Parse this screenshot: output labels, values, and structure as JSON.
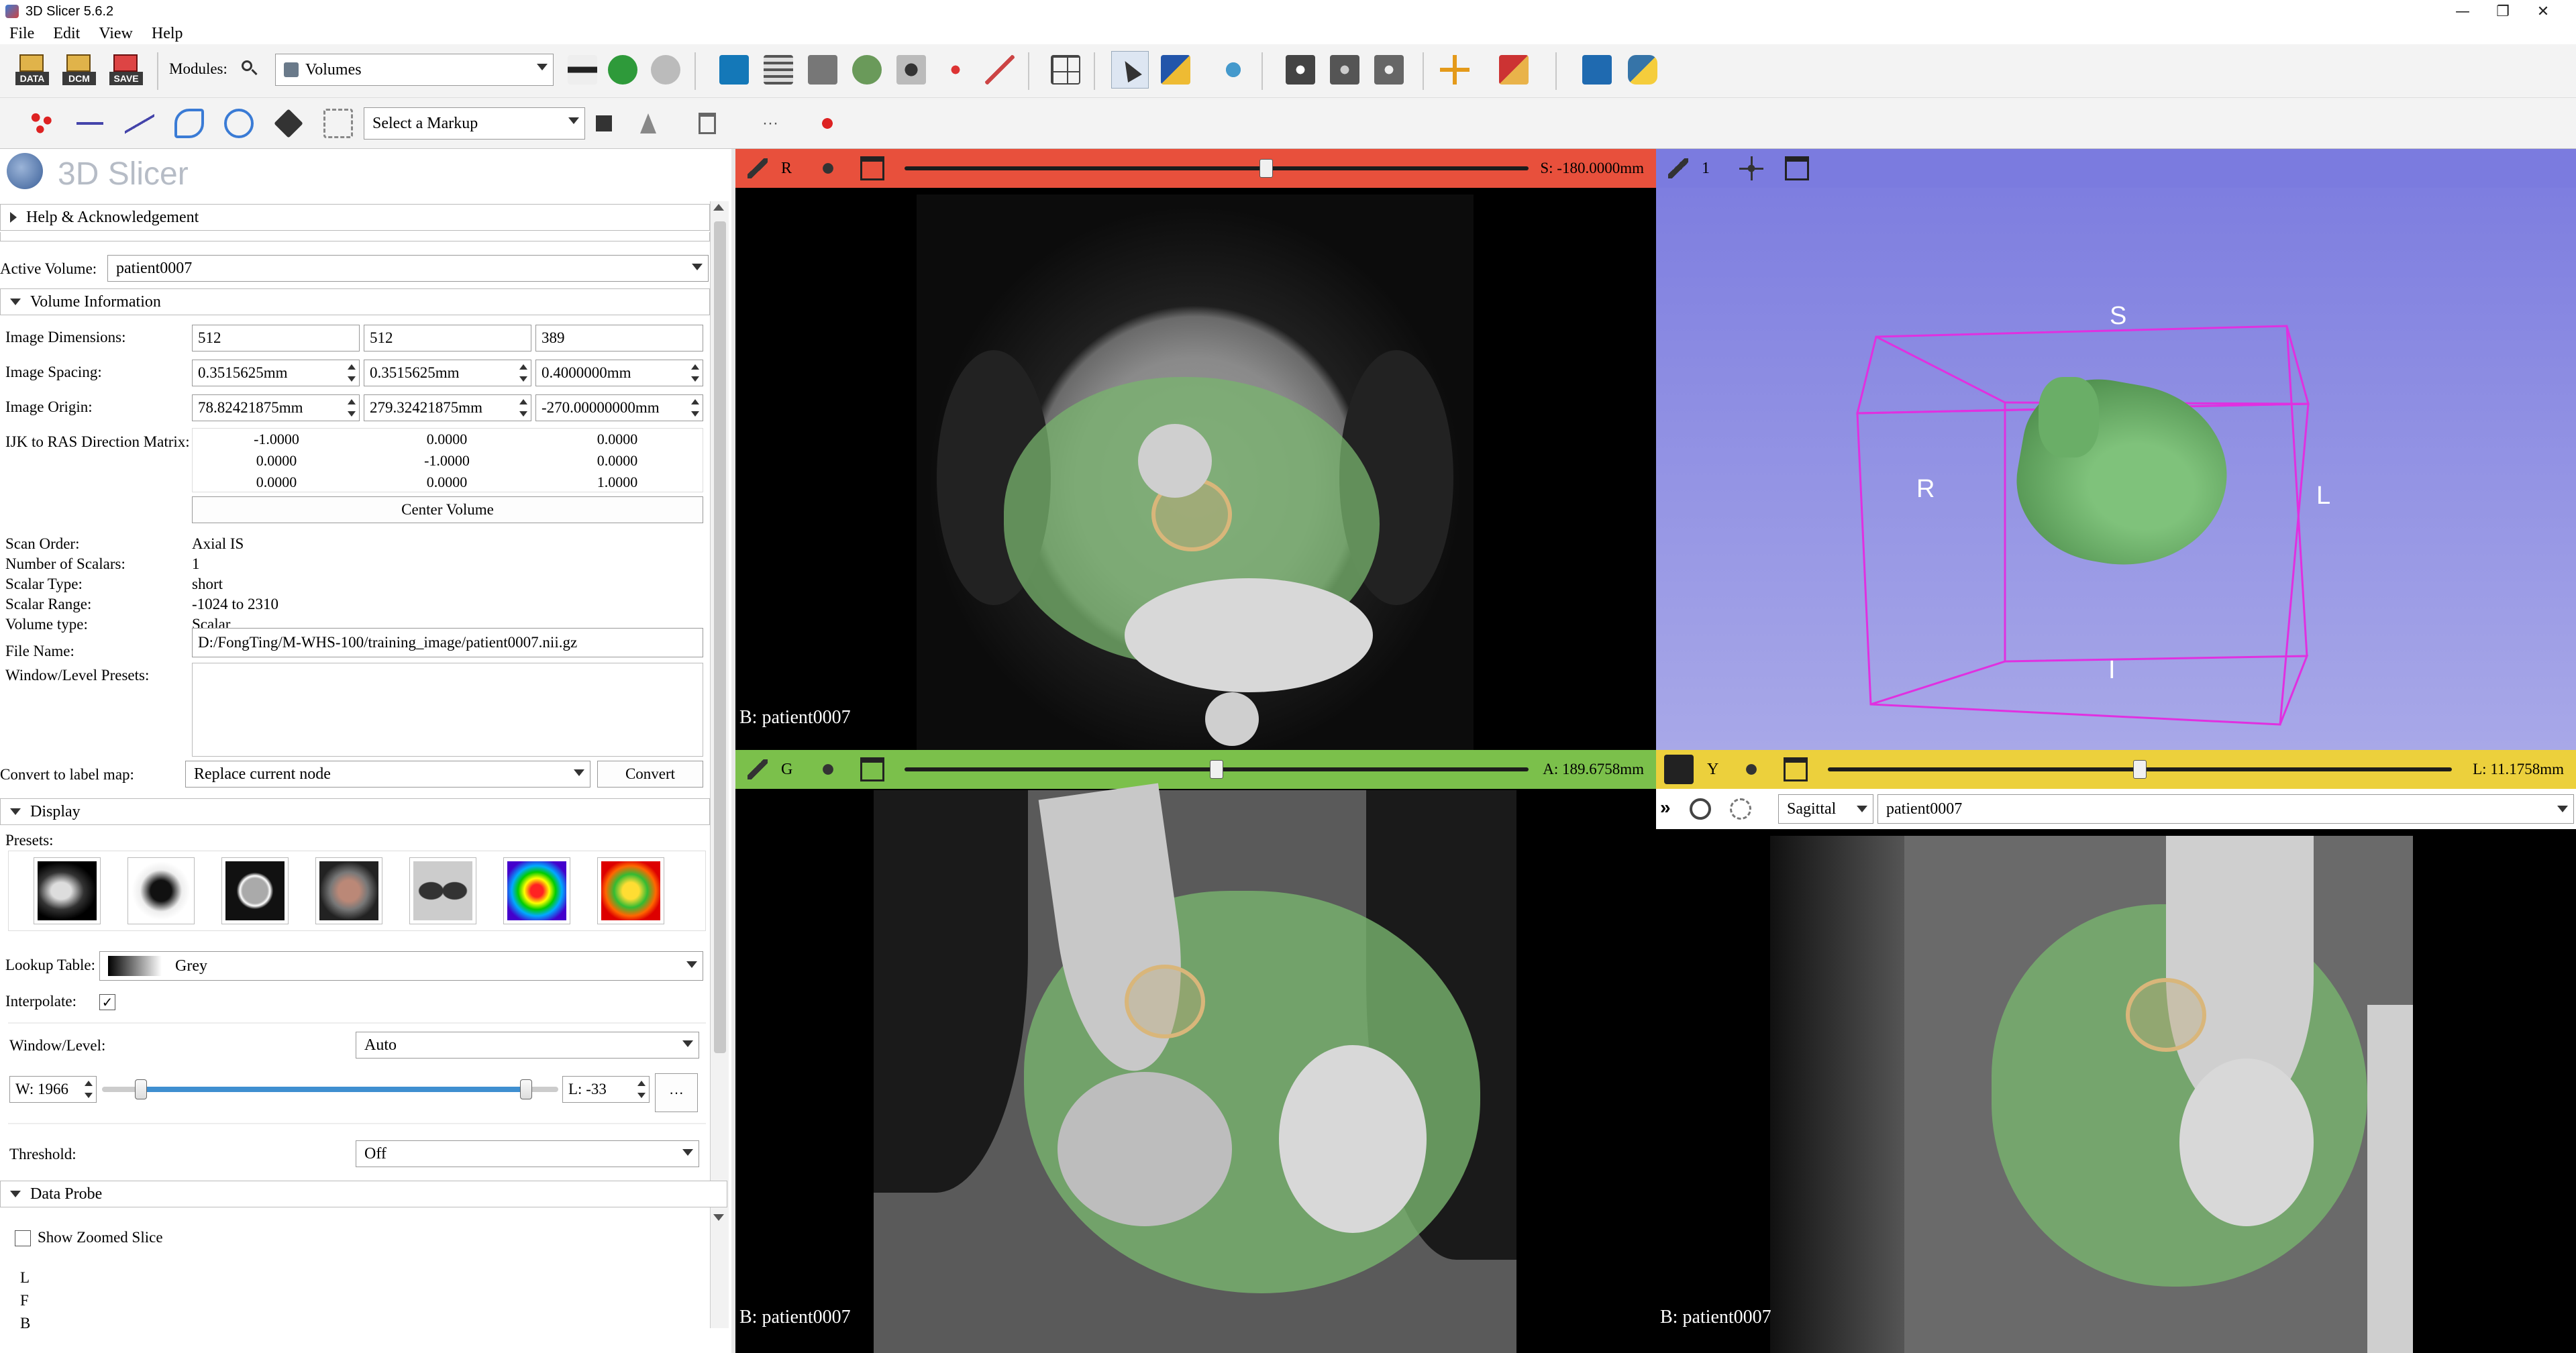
{
  "window": {
    "title": "3D Slicer 5.6.2",
    "controls": [
      "—",
      "❐",
      "✕"
    ]
  },
  "menu": [
    "File",
    "Edit",
    "View",
    "Help"
  ],
  "toolbar1": {
    "data_label": "DATA",
    "dcm_label": "DCM",
    "save_label": "SAVE",
    "modules_label": "Modules:",
    "module_selected": "Volumes"
  },
  "toolbar2": {
    "markup_placeholder": "Select a Markup"
  },
  "left_panel": {
    "logo_text": "3D Slicer",
    "help_section": "Help & Acknowledgement",
    "active_volume_label": "Active Volume:",
    "active_volume": "patient0007",
    "volume_info_section": "Volume Information",
    "image_dimensions_label": "Image Dimensions:",
    "image_dimensions": [
      "512",
      "512",
      "389"
    ],
    "image_spacing_label": "Image Spacing:",
    "image_spacing": [
      "0.3515625mm",
      "0.3515625mm",
      "0.4000000mm"
    ],
    "image_origin_label": "Image Origin:",
    "image_origin": [
      "78.82421875mm",
      "279.32421875mm",
      "-270.00000000mm"
    ],
    "ijk_label": "IJK to RAS Direction Matrix:",
    "ijk_matrix": [
      [
        "-1.0000",
        "0.0000",
        "0.0000"
      ],
      [
        "0.0000",
        "-1.0000",
        "0.0000"
      ],
      [
        "0.0000",
        "0.0000",
        "1.0000"
      ]
    ],
    "center_volume": "Center Volume",
    "scan_order_label": "Scan Order:",
    "scan_order": "Axial IS",
    "num_scalars_label": "Number of Scalars:",
    "num_scalars": "1",
    "scalar_type_label": "Scalar Type:",
    "scalar_type": "short",
    "scalar_range_label": "Scalar Range:",
    "scalar_range": "-1024 to 2310",
    "volume_type_label": "Volume type:",
    "volume_type": "Scalar",
    "file_name_label": "File Name:",
    "file_name": "D:/FongTing/M-WHS-100/training_image/patient0007.nii.gz",
    "wl_presets_label": "Window/Level Presets:",
    "convert_label": "Convert to label map:",
    "convert_option": "Replace current node",
    "convert_button": "Convert",
    "display_section": "Display",
    "presets_label": "Presets:",
    "lookup_label": "Lookup Table:",
    "lookup_value": "Grey",
    "interpolate_label": "Interpolate:",
    "interpolate_check": "✓",
    "wl_label": "Window/Level:",
    "wl_mode": "Auto",
    "window_value": "W: 1966",
    "level_value": "L: -33",
    "window_level_slider": {
      "min": 0.085,
      "max": 0.93
    },
    "threshold_label": "Threshold:",
    "threshold_value": "Off",
    "data_probe_section": "Data Probe",
    "show_zoomed_label": "Show Zoomed Slice",
    "probe_lines": [
      "L",
      "F",
      "B"
    ]
  },
  "views": {
    "red": {
      "label": "R",
      "offset": "S: -180.0000mm",
      "patient": "B: patient0007",
      "slider_pos": 0.58,
      "color": "#e8503c"
    },
    "threed": {
      "label": "1",
      "color": "#7b7bdf",
      "orient": {
        "S": "S",
        "R": "R",
        "L": "L",
        "I": "I"
      }
    },
    "green": {
      "label": "G",
      "offset": "A: 189.6758mm",
      "patient": "B: patient0007",
      "slider_pos": 0.5,
      "color": "#7bc04b"
    },
    "yellow": {
      "label": "Y",
      "offset": "L: 11.1758mm",
      "patient": "B: patient0007",
      "slider_pos": 0.5,
      "color": "#ecd03c",
      "orientation": "Sagittal",
      "volume": "patient0007"
    }
  }
}
